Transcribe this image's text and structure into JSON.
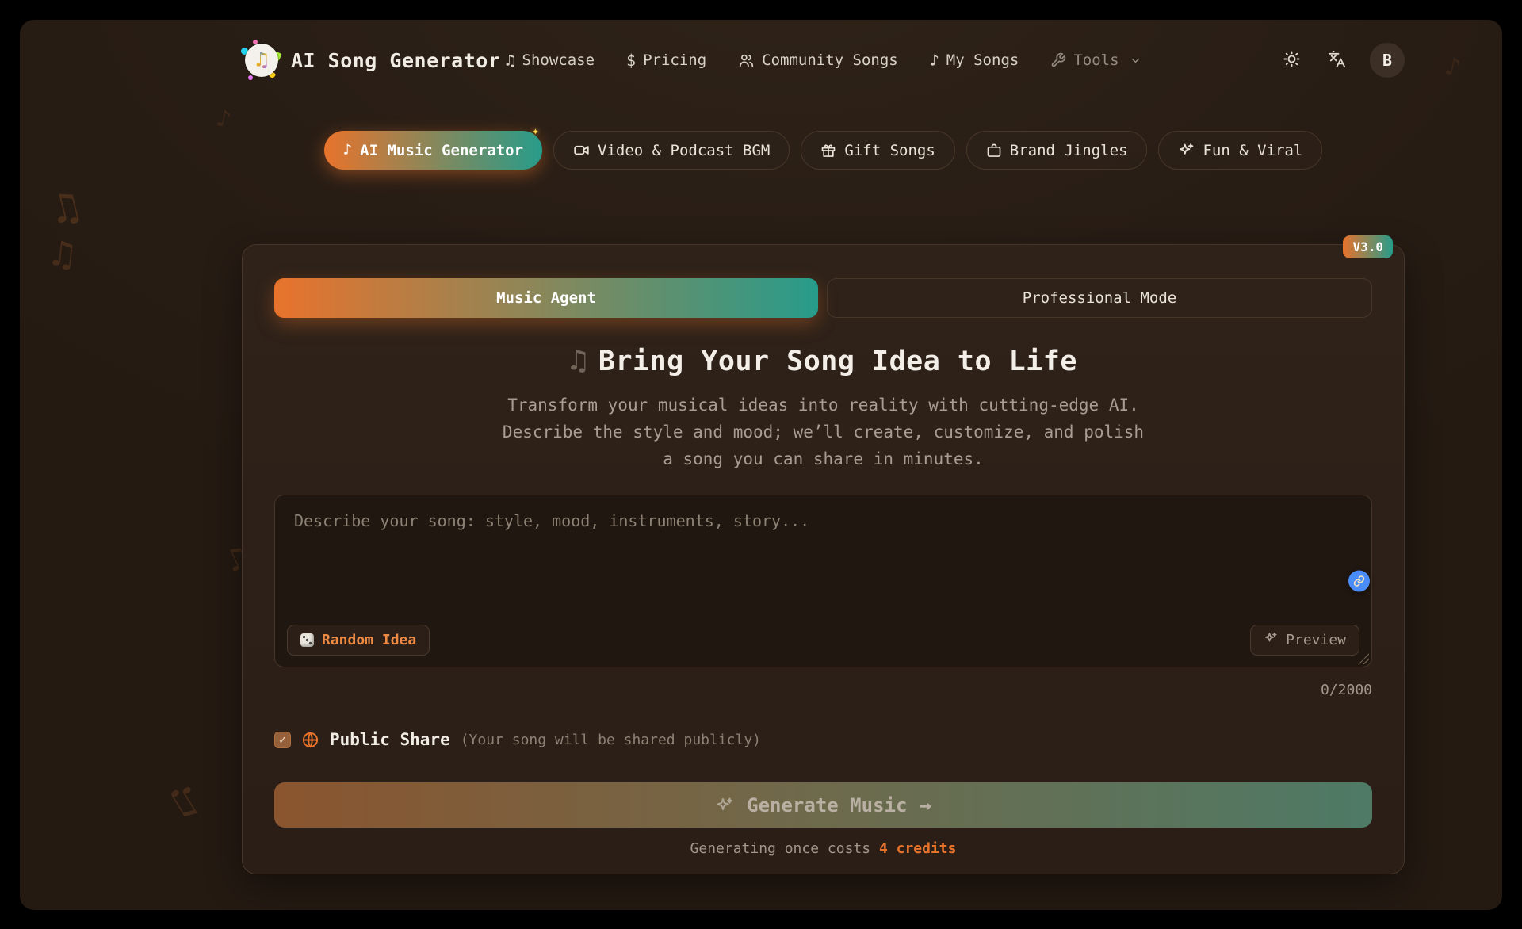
{
  "icons": {
    "music_note": "♪",
    "beamed_note": "♫",
    "dollar": "$",
    "arrow_right": "→",
    "check": "✓"
  },
  "header": {
    "title": "AI Song Generator",
    "nav": [
      {
        "label": "Showcase"
      },
      {
        "label": "Pricing"
      },
      {
        "label": "Community Songs"
      },
      {
        "label": "My Songs"
      },
      {
        "label": "Tools"
      }
    ],
    "avatar_initial": "B"
  },
  "category_tabs": [
    {
      "label": "AI Music Generator",
      "active": true
    },
    {
      "label": "Video & Podcast BGM",
      "active": false
    },
    {
      "label": "Gift Songs",
      "active": false
    },
    {
      "label": "Brand Jingles",
      "active": false
    },
    {
      "label": "Fun & Viral",
      "active": false
    }
  ],
  "generator": {
    "version_badge": "V3.0",
    "mode_active": "Music Agent",
    "mode_inactive": "Professional Mode",
    "heading": "Bring Your Song Idea to Life",
    "description": "Transform your musical ideas into reality with cutting-edge AI. Describe the style and mood; we’ll create, customize, and polish a song you can share in minutes.",
    "prompt_placeholder": "Describe your song: style, mood, instruments, story...",
    "random_idea_label": "Random Idea",
    "preview_label": "Preview",
    "char_counter": "0/2000",
    "public_share_label": "Public Share",
    "public_share_note": "(Your song will be shared publicly)",
    "public_share_checked": true,
    "generate_label": "Generate Music",
    "credits_prefix": "Generating once costs",
    "credits_highlight": "4 credits"
  },
  "colors": {
    "accent_orange": "#e8732c",
    "accent_teal": "#279c8a",
    "link_button_blue": "#4b8df8"
  }
}
